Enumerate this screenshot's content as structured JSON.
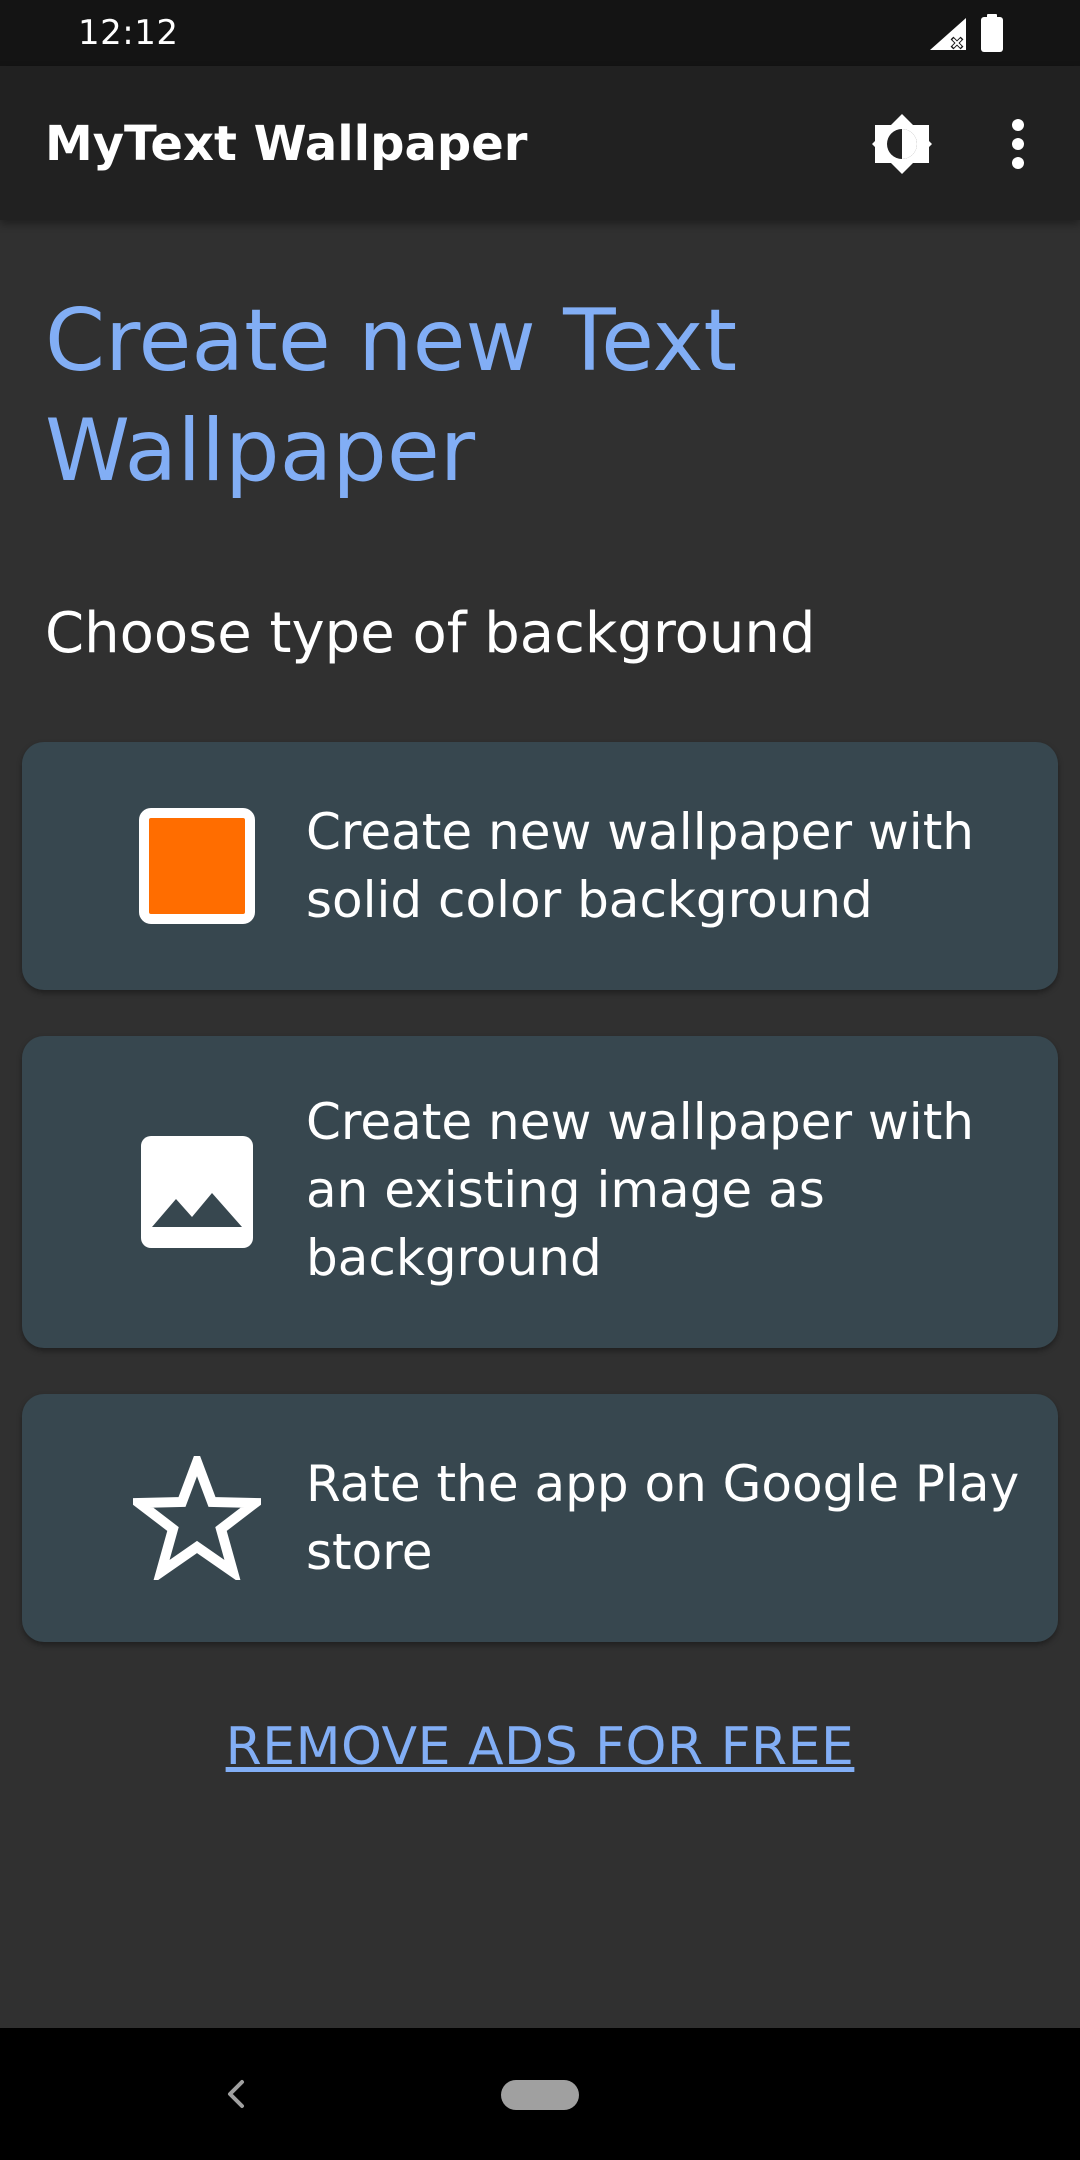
{
  "status_bar": {
    "time": "12:12",
    "signal_icon": "signal-off-icon",
    "battery_icon": "battery-full-icon"
  },
  "app_bar": {
    "title": "MyText Wallpaper",
    "theme_icon": "brightness-icon",
    "more_icon": "more-vert-icon"
  },
  "main": {
    "heading": "Create new Text Wallpaper",
    "subheading": "Choose type of background",
    "options": [
      {
        "label": "Create new wallpaper with solid color background",
        "icon": "solid-color-swatch-icon",
        "swatch_color": "#ff6d00"
      },
      {
        "label": "Create new wallpaper with an existing image as background",
        "icon": "image-icon"
      },
      {
        "label": "Rate the app on Google Play store",
        "icon": "star-outline-icon"
      }
    ],
    "remove_ads_link": "REMOVE ADS FOR FREE"
  },
  "colors": {
    "background": "#303030",
    "app_bar": "#212121",
    "card": "#37474f",
    "accent": "#82aef5"
  },
  "nav_bar": {
    "back_icon": "back-chevron-icon",
    "home_icon": "home-pill-icon"
  }
}
